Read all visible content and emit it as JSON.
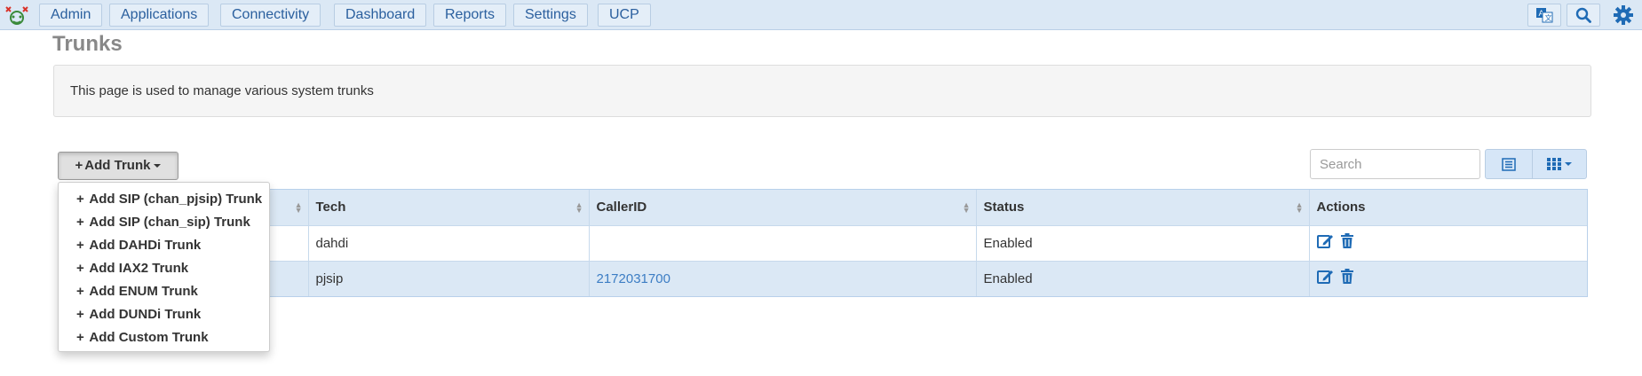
{
  "nav": {
    "items": [
      {
        "label": "Admin"
      },
      {
        "label": "Applications"
      },
      {
        "label": "Connectivity"
      },
      {
        "label": "Dashboard"
      },
      {
        "label": "Reports"
      },
      {
        "label": "Settings"
      },
      {
        "label": "UCP"
      }
    ],
    "icons": [
      "translate-icon",
      "search-icon",
      "gear-icon"
    ]
  },
  "page": {
    "title": "Trunks",
    "info": "This page is used to manage various system trunks"
  },
  "toolbar": {
    "add_label": "Add Trunk",
    "search_placeholder": "Search"
  },
  "dropdown": {
    "items": [
      "Add SIP (chan_pjsip) Trunk",
      "Add SIP (chan_sip) Trunk",
      "Add DAHDi Trunk",
      "Add IAX2 Trunk",
      "Add ENUM Trunk",
      "Add DUNDi Trunk",
      "Add Custom Trunk"
    ]
  },
  "table": {
    "columns": [
      "",
      "Tech",
      "CallerID",
      "Status",
      "Actions"
    ],
    "rows": [
      {
        "tech": "dahdi",
        "callerid": "",
        "status": "Enabled"
      },
      {
        "tech": "pjsip",
        "callerid": "2172031700",
        "status": "Enabled"
      }
    ]
  },
  "colors": {
    "nav_bg": "#dbe8f5",
    "link": "#3c7dc4",
    "accent": "#1f6bb5"
  }
}
